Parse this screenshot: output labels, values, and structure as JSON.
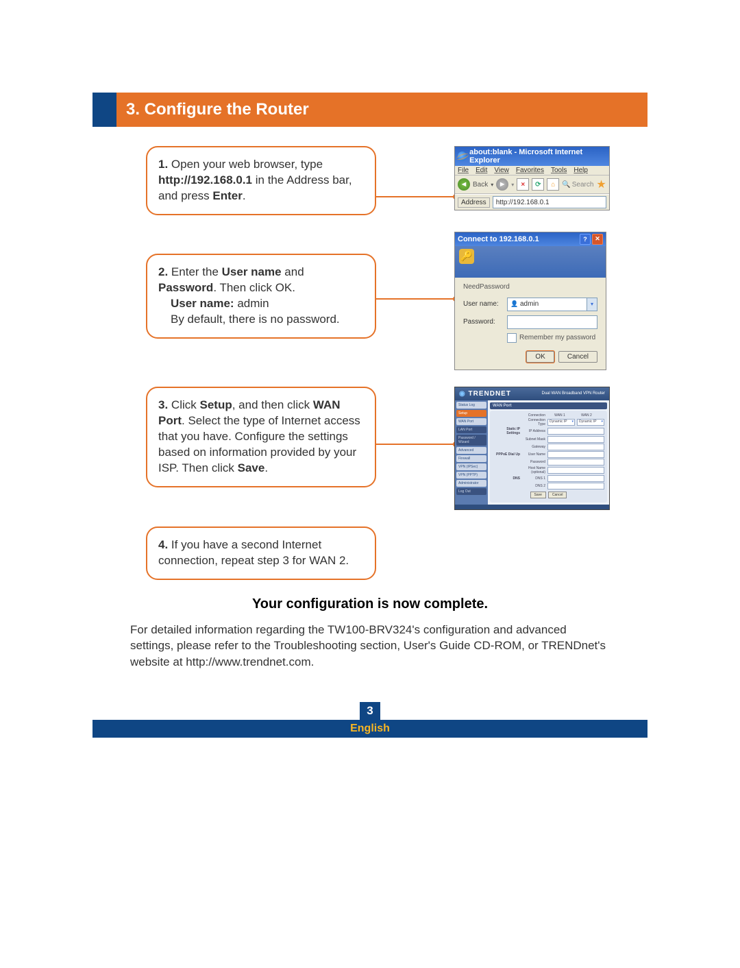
{
  "header": {
    "title": "3. Configure the Router"
  },
  "steps": [
    {
      "num": "1.",
      "pre": "Open your web browser, type ",
      "b1": "http://192.168.0.1",
      "mid": " in the Address bar, and press ",
      "b2": "Enter",
      "post": "."
    },
    {
      "num": "2.",
      "line1_pre": "Enter the ",
      "line1_b1": "User name",
      "line1_mid": " and ",
      "line1_b2": "Password",
      "line1_post": ".  Then click OK.",
      "line2_b": "User name:",
      "line2_val": " admin",
      "line3": "By default, there is no password."
    },
    {
      "num": "3.",
      "pre": "Click ",
      "b1": "Setup",
      "mid1": ", and then click ",
      "b2": "WAN Port",
      "mid2": ".  Select the type of Internet access that you have.  Configure the settings based on information provided by your ISP.  Then click ",
      "b3": "Save",
      "post": "."
    },
    {
      "num": "4.",
      "text": "If you have a second Internet connection, repeat step 3 for WAN 2."
    }
  ],
  "ie": {
    "title": "about:blank - Microsoft Internet Explorer",
    "menu": [
      "File",
      "Edit",
      "View",
      "Favorites",
      "Tools",
      "Help"
    ],
    "back": "Back",
    "search": "Search",
    "address_label": "Address",
    "address_value": "http://192.168.0.1"
  },
  "login": {
    "title": "Connect to 192.168.0.1",
    "need": "NeedPassword",
    "user_label": "User name:",
    "pass_label": "Password:",
    "user_value": "admin",
    "remember": "Remember my password",
    "ok": "OK",
    "cancel": "Cancel"
  },
  "router": {
    "brand": "TRENDNET",
    "subtitle": "Dual WAN Broadband VPN Router",
    "sidebar": [
      "Status Log",
      "Setup",
      "WAN Port",
      "LAN Port",
      "Password / Wizard",
      "Advanced",
      "Firewall",
      "VPN (IPSec)",
      "VPN (PPTP)",
      "Administrator",
      "Log Out"
    ],
    "wan_title": "WAN Port",
    "fields": {
      "connection": "Connection",
      "conn_type": "Connection Type",
      "wan1": "WAN 1",
      "wan2": "WAN 2",
      "dynamic": "Dynamic IP",
      "static_sec": "Static IP Settings",
      "ip": "IP Address",
      "subnet": "Subnet Mask",
      "gateway": "Gateway",
      "pppoe_sec": "PPPoE Dial Up",
      "user": "User Name",
      "pass": "Password",
      "host": "Host Name (optional)",
      "dns": "DNS",
      "dns1": "DNS 1",
      "dns2": "DNS 2"
    },
    "save": "Save",
    "cancel": "Cancel"
  },
  "conclusion": "Your configuration is now complete.",
  "detail": "For detailed information regarding the TW100-BRV324's configuration and advanced settings, please refer to the Troubleshooting section, User's Guide CD-ROM, or TRENDnet's website at http://www.trendnet.com.",
  "footer": {
    "page": "3",
    "lang": "English"
  }
}
